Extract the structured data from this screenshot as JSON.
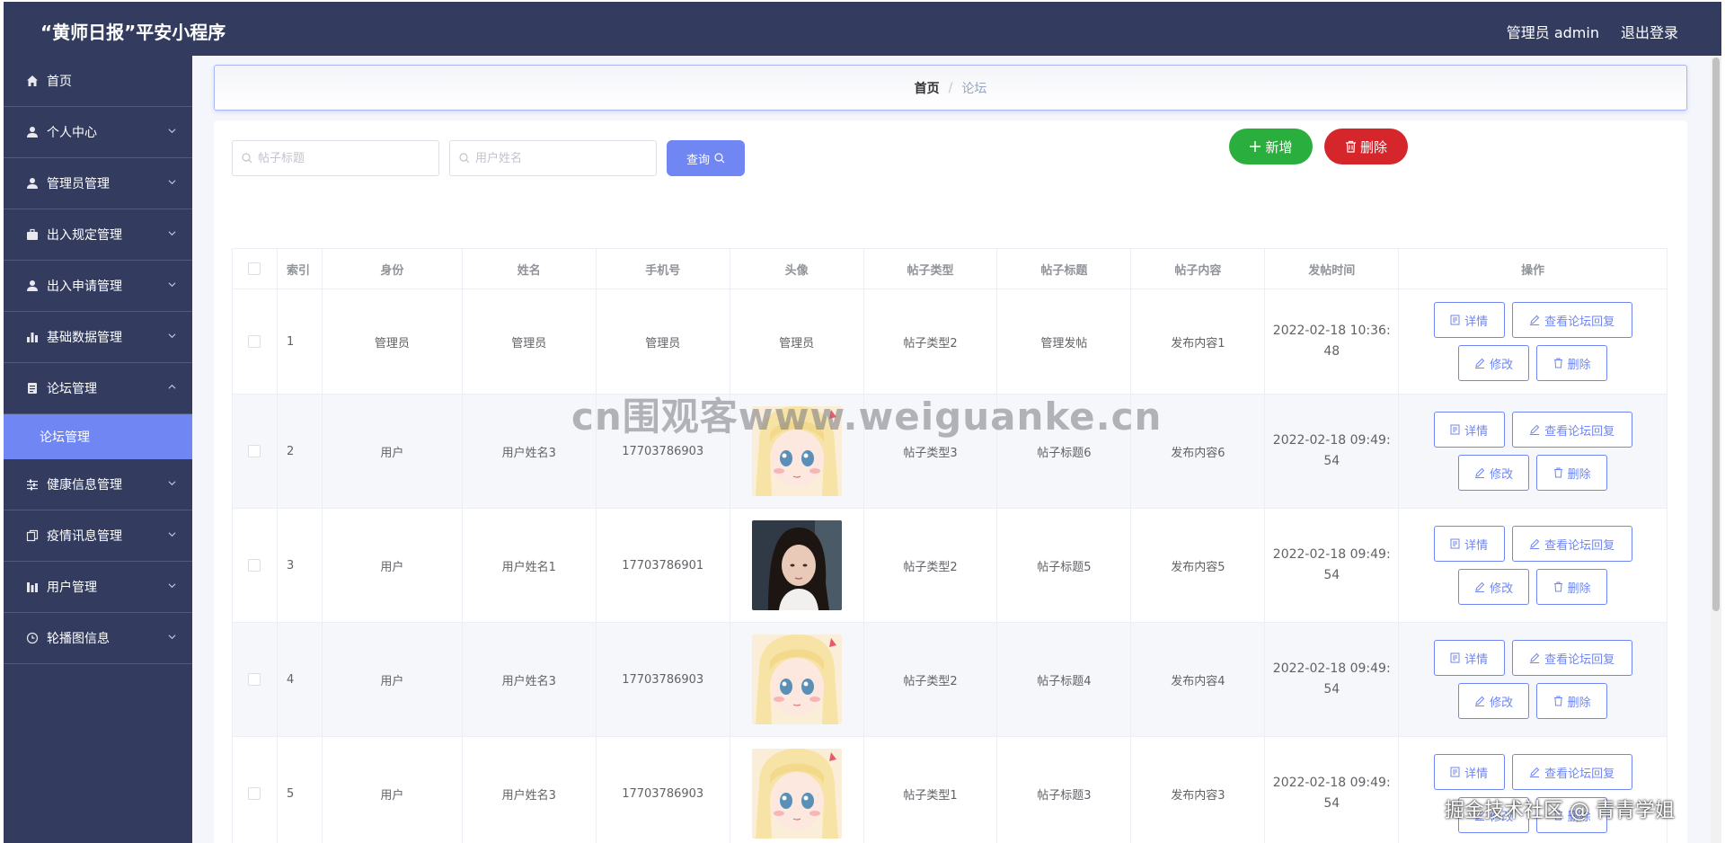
{
  "header": {
    "title": "“黄师日报”平安小程序",
    "user_label": "管理员 admin",
    "logout_label": "退出登录"
  },
  "sidebar": {
    "items": [
      {
        "label": "首页",
        "icon": "home-icon"
      },
      {
        "label": "个人中心",
        "icon": "user-icon"
      },
      {
        "label": "管理员管理",
        "icon": "user-icon"
      },
      {
        "label": "出入规定管理",
        "icon": "briefcase-icon"
      },
      {
        "label": "出入申请管理",
        "icon": "user-icon"
      },
      {
        "label": "基础数据管理",
        "icon": "bar-chart-icon"
      },
      {
        "label": "论坛管理",
        "icon": "document-icon"
      },
      {
        "label": "健康信息管理",
        "icon": "sliders-icon"
      },
      {
        "label": "疫情讯息管理",
        "icon": "copy-icon"
      },
      {
        "label": "用户管理",
        "icon": "bar-chart-icon"
      },
      {
        "label": "轮播图信息",
        "icon": "clock-icon"
      }
    ],
    "active_sub": "论坛管理"
  },
  "breadcrumb": {
    "home": "首页",
    "separator": "/",
    "current": "论坛"
  },
  "search": {
    "title_placeholder": "帖子标题",
    "name_placeholder": "用户姓名",
    "query_label": "查询"
  },
  "actions": {
    "add_label": "新增",
    "delete_label": "删除"
  },
  "table": {
    "columns": [
      "索引",
      "身份",
      "姓名",
      "手机号",
      "头像",
      "帖子类型",
      "帖子标题",
      "帖子内容",
      "发帖时间",
      "操作"
    ],
    "op_labels": {
      "detail": "详情",
      "reply": "查看论坛回复",
      "edit": "修改",
      "remove": "删除"
    },
    "rows": [
      {
        "index": "1",
        "role": "管理员",
        "name": "管理员",
        "phone": "管理员",
        "avatar": "管理员",
        "type": "帖子类型2",
        "title": "管理发帖",
        "content": "发布内容1",
        "time_a": "2022-02-18 10:36:",
        "time_b": "48"
      },
      {
        "index": "2",
        "role": "用户",
        "name": "用户姓名3",
        "phone": "17703786903",
        "avatar": "anime-girl",
        "type": "帖子类型3",
        "title": "帖子标题6",
        "content": "发布内容6",
        "time_a": "2022-02-18 09:49:",
        "time_b": "54"
      },
      {
        "index": "3",
        "role": "用户",
        "name": "用户姓名1",
        "phone": "17703786901",
        "avatar": "photo-girl",
        "type": "帖子类型2",
        "title": "帖子标题5",
        "content": "发布内容5",
        "time_a": "2022-02-18 09:49:",
        "time_b": "54"
      },
      {
        "index": "4",
        "role": "用户",
        "name": "用户姓名3",
        "phone": "17703786903",
        "avatar": "anime-girl",
        "type": "帖子类型2",
        "title": "帖子标题4",
        "content": "发布内容4",
        "time_a": "2022-02-18 09:49:",
        "time_b": "54"
      },
      {
        "index": "5",
        "role": "用户",
        "name": "用户姓名3",
        "phone": "17703786903",
        "avatar": "anime-girl",
        "type": "帖子类型1",
        "title": "帖子标题3",
        "content": "发布内容3",
        "time_a": "2022-02-18 09:49:",
        "time_b": "54"
      }
    ]
  },
  "watermarks": {
    "center": "cn围观客www.weiguanke.cn",
    "bottom": "掘金技术社区 @ 青青学姐"
  },
  "colors": {
    "header_bg": "#333c5e",
    "accent": "#6f86f3",
    "add_green": "#2aae3e",
    "delete_red": "#d5262c"
  }
}
